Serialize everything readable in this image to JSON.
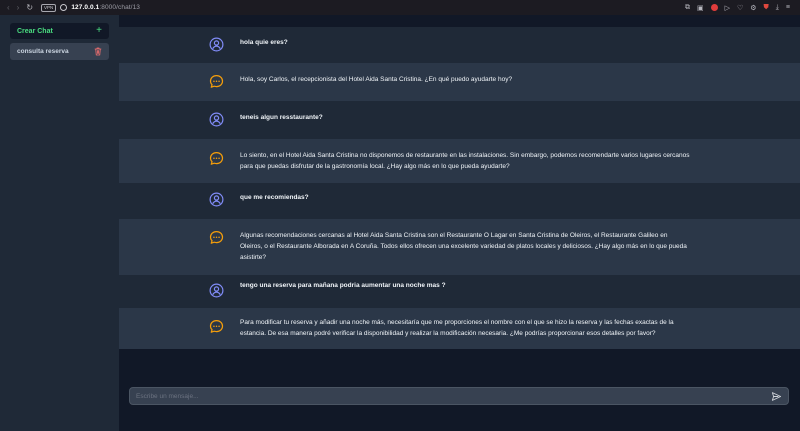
{
  "browser": {
    "vpn_label": "VPN",
    "url_host": "127.0.0.1",
    "url_path": ":8000/chat/13",
    "icons": [
      "back-icon",
      "forward-icon",
      "reload-icon",
      "globe-icon",
      "screenshot-icon",
      "camera-icon",
      "record-icon",
      "play-icon",
      "heart-icon",
      "settings-icon",
      "shield-icon",
      "download-icon",
      "menu-icon"
    ]
  },
  "sidebar": {
    "new_chat_label": "Crear Chat",
    "new_chat_icon": "plus-icon",
    "chats": [
      {
        "label": "consulta reserva",
        "icon": "trash-icon"
      }
    ]
  },
  "messages": [
    {
      "role": "user",
      "text": "hola quie eres?"
    },
    {
      "role": "bot",
      "text": "Hola, soy Carlos, el recepcionista del Hotel Aida Santa Cristina. ¿En qué puedo ayudarte hoy?"
    },
    {
      "role": "user",
      "text": "teneis algun resstaurante?"
    },
    {
      "role": "bot",
      "text": "Lo siento, en el Hotel Aida Santa Cristina no disponemos de restaurante en las instalaciones. Sin embargo, podemos recomendarte varios lugares cercanos para que puedas disfrutar de la gastronomía local. ¿Hay algo más en lo que pueda ayudarte?"
    },
    {
      "role": "user",
      "text": "que me recomiendas?"
    },
    {
      "role": "bot",
      "text": "Algunas recomendaciones cercanas al Hotel Aida Santa Cristina son el Restaurante O Lagar en Santa Cristina de Oleiros, el Restaurante Galileo en Oleiros, o el Restaurante Alborada en A Coruña. Todos ellos ofrecen una excelente variedad de platos locales y deliciosos. ¿Hay algo más en lo que pueda asistirte?"
    },
    {
      "role": "user",
      "text": "tengo una reserva para mañana podria aumentar una noche mas ?"
    },
    {
      "role": "bot",
      "text": "Para modificar tu reserva y añadir una noche más, necesitaría que me proporciones el nombre con el que se hizo la reserva y las fechas exactas de la estancia. De esa manera podré verificar la disponibilidad y realizar la modificación necesaria. ¿Me podrías proporcionar esos detalles por favor?"
    }
  ],
  "input": {
    "placeholder": "Escribe un mensaje...",
    "value": "",
    "send_icon": "send-icon"
  },
  "colors": {
    "accent_green": "#4ade80",
    "user_avatar": "#818cf8",
    "bot_avatar": "#f59e0b",
    "trash": "#f87171"
  }
}
